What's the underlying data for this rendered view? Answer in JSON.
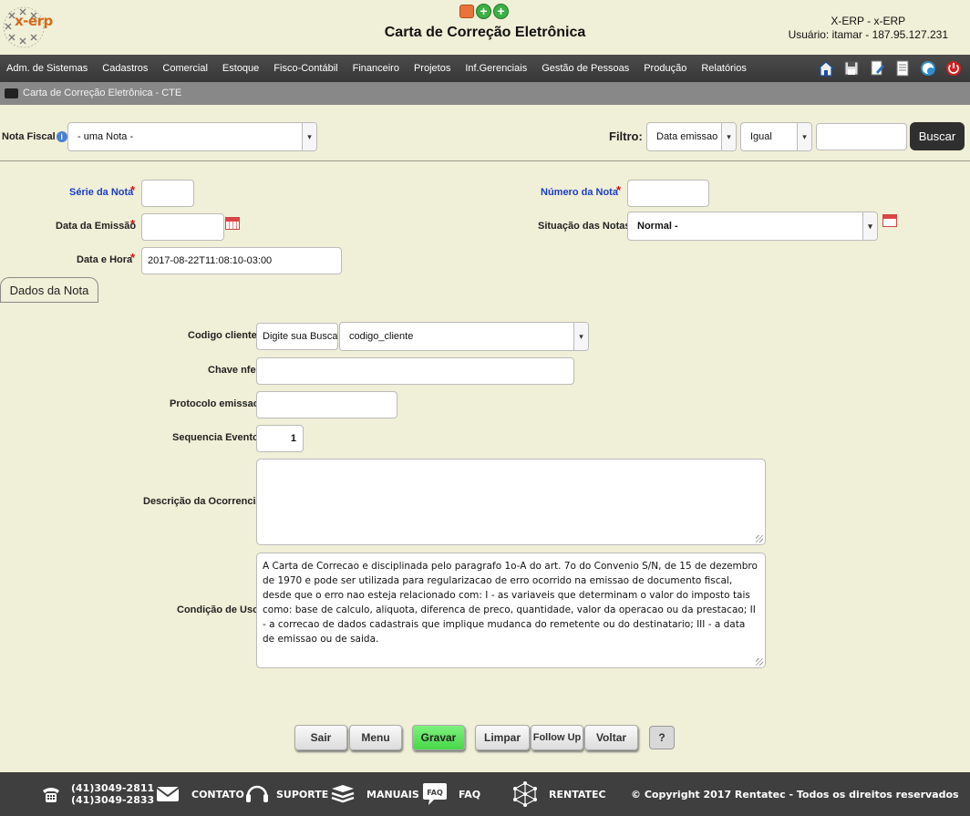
{
  "header": {
    "logo_text": "x-erp",
    "title": "Carta de Correção Eletrônica",
    "system": "X-ERP - x-ERP",
    "user": "Usuário: itamar - 187.95.127.231",
    "plus_glyph": "+"
  },
  "menu": {
    "items": [
      "Adm. de Sistemas",
      "Cadastros",
      "Comercial",
      "Estoque",
      "Fisco-Contábil",
      "Financeiro",
      "Projetos",
      "Inf.Gerenciais",
      "Gestão de Pessoas",
      "Produção",
      "Relatórios"
    ]
  },
  "breadcrumb": "Carta de Correção Eletrônica - CTE",
  "filter": {
    "nota_label": "Nota Fiscal",
    "nota_value": "- uma Nota -",
    "filtro_label": "Filtro:",
    "field_value": "Data emissao",
    "operator_value": "Igual",
    "search_value": "",
    "buscar_label": "Buscar"
  },
  "form": {
    "serie_label": "Série da Nota",
    "serie_value": "",
    "numero_label": "Número da Nota",
    "numero_value": "",
    "data_emissao_label": "Data da Emissão",
    "data_emissao_value": "",
    "situacao_label": "Situação das Notas",
    "situacao_value": "Normal -",
    "data_hora_label": "Data e Hora",
    "data_hora_value": "2017-08-22T11:08:10-03:00",
    "required_mark": "*",
    "info_glyph": "i",
    "dropdown_glyph": "▾"
  },
  "tab": {
    "label": "Dados da Nota"
  },
  "details": {
    "codigo_label": "Codigo cliente",
    "codigo_search_placeholder": "Digite sua Busca",
    "codigo_select_value": "codigo_cliente",
    "chave_label": "Chave nfe",
    "chave_value": "",
    "protocolo_label": "Protocolo emissao",
    "protocolo_value": "",
    "sequencia_label": "Sequencia Evento",
    "sequencia_value": "1",
    "descricao_label": "Descrição da Ocorrencia",
    "descricao_value": "",
    "condicao_label": "Condição de Uso",
    "condicao_value": "A Carta de Correcao e disciplinada pelo paragrafo 1o-A do art. 7o do Convenio S/N, de 15 de dezembro de 1970 e pode ser utilizada para regularizacao de erro ocorrido na emissao de documento fiscal, desde que o erro nao esteja relacionado com: I - as variaveis que determinam o valor do imposto tais como: base de calculo, aliquota, diferenca de preco, quantidade, valor da operacao ou da prestacao; II - a correcao de dados cadastrais que implique mudanca do remetente ou do destinatario; III - a data de emissao ou de saida."
  },
  "buttons": {
    "sair": "Sair",
    "menu": "Menu",
    "gravar": "Gravar",
    "limpar": "Limpar",
    "followup": "Follow Up",
    "voltar": "Voltar",
    "help": "?"
  },
  "footer": {
    "phone1": "(41)3049-2811",
    "phone2": "(41)3049-2833",
    "contato": "CONTATO",
    "suporte": "SUPORTE",
    "manuais": "MANUAIS",
    "faq": "FAQ",
    "faq_bubble": "FAQ",
    "rentatec": "RENTATEC",
    "copyright": "© Copyright 2017 Rentatec - Todos os direitos reservados"
  },
  "colors": {
    "background": "#f0efd7",
    "menubar": "#3f3f3f",
    "breadcrumb": "#888888",
    "required": "#d01010",
    "label_blue": "#1a3ec7",
    "gravar_green": "#48d848"
  },
  "icons": {
    "header": [
      "powerpoint-icon",
      "add-icon",
      "add-icon"
    ],
    "menu_right": [
      "home-icon",
      "save-icon",
      "edit-icon",
      "document-icon",
      "refresh-icon",
      "power-icon"
    ],
    "footer": [
      "phone-icon",
      "mail-icon",
      "headset-icon",
      "books-icon",
      "faq-icon",
      "network-icon"
    ]
  }
}
